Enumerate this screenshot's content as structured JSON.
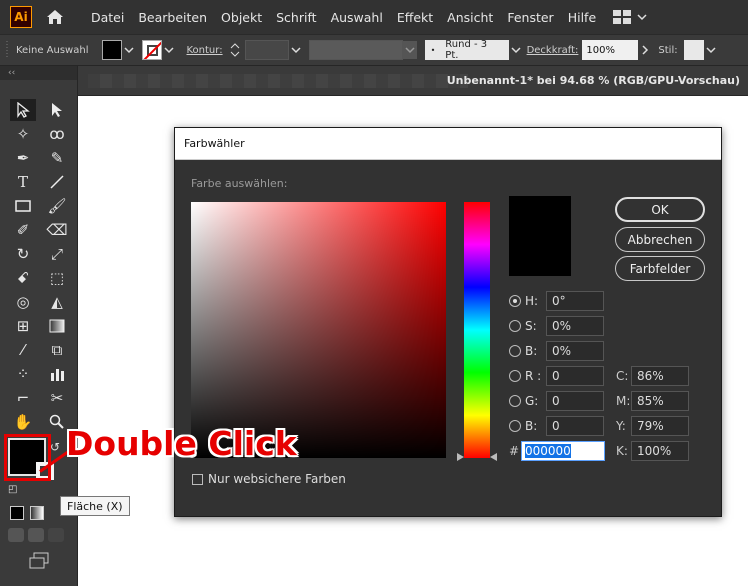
{
  "app": {
    "logo": "Ai"
  },
  "menu": [
    "Datei",
    "Bearbeiten",
    "Objekt",
    "Schrift",
    "Auswahl",
    "Effekt",
    "Ansicht",
    "Fenster",
    "Hilfe"
  ],
  "control_bar": {
    "selection_label": "Keine Auswahl",
    "kontur_label": "Kontur:",
    "brush_label": "Rund - 3 Pt.",
    "opacity_label": "Deckkraft:",
    "opacity_value": "100%",
    "style_label": "Stil:"
  },
  "document_tab": "Unbenannt-1* bei 94.68 % (RGB/GPU-Vorschau)",
  "dialog": {
    "title": "Farbwähler",
    "select_label": "Farbe auswählen:",
    "buttons": {
      "ok": "OK",
      "cancel": "Abbrechen",
      "swatches": "Farbfelder"
    },
    "fields": {
      "h": {
        "label": "H:",
        "value": "0°"
      },
      "s": {
        "label": "S:",
        "value": "0%"
      },
      "b": {
        "label": "B:",
        "value": "0%"
      },
      "r": {
        "label": "R :",
        "value": "0"
      },
      "g": {
        "label": "G:",
        "value": "0"
      },
      "bb": {
        "label": "B:",
        "value": "0"
      },
      "hex_label": "#",
      "hex_value": "000000",
      "c": {
        "label": "C:",
        "value": "86%"
      },
      "m": {
        "label": "M:",
        "value": "85%"
      },
      "y": {
        "label": "Y:",
        "value": "79%"
      },
      "k": {
        "label": "K:",
        "value": "100%"
      }
    },
    "websafe_label": "Nur websichere Farben",
    "current_color": "#000000"
  },
  "tooltip": "Fläche (X)",
  "annotation": "Double Click",
  "colors": {
    "annotation_red": "#e60000",
    "accent_blue": "#1473e6"
  }
}
